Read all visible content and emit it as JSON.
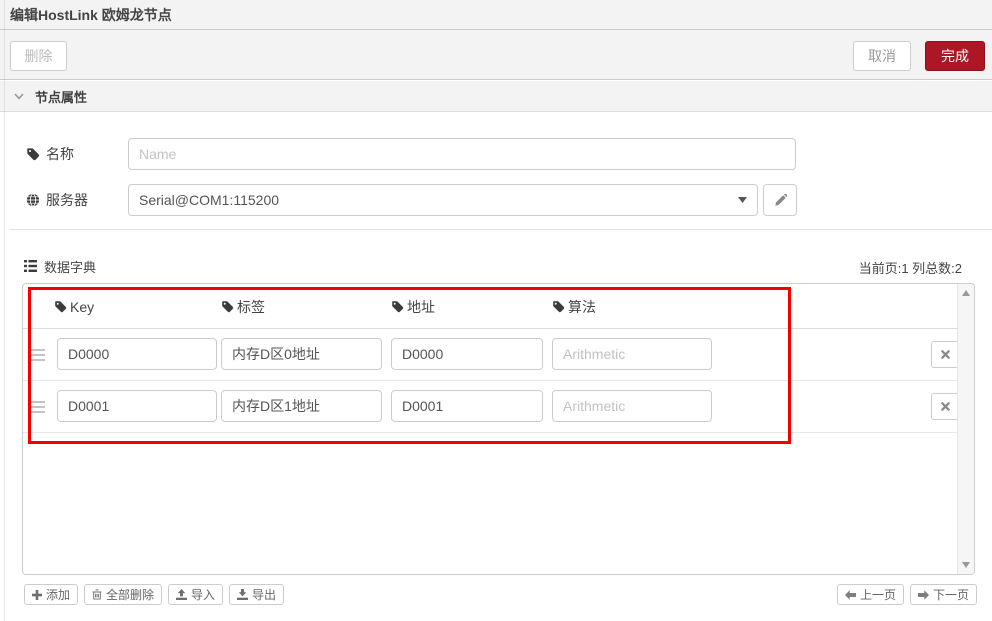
{
  "window": {
    "title": "编辑HostLink 欧姆龙节点"
  },
  "toolbar": {
    "delete": "删除",
    "cancel": "取消",
    "done": "完成"
  },
  "section": {
    "title": "节点属性"
  },
  "form": {
    "name_label": "名称",
    "name_placeholder": "Name",
    "server_label": "服务器",
    "server_value": "Serial@COM1:115200"
  },
  "dictionary": {
    "title": "数据字典",
    "page_info": "当前页:1  列总数:2",
    "columns": {
      "key": "Key",
      "label": "标签",
      "address": "地址",
      "algorithm": "算法"
    },
    "rows": [
      {
        "key": "D0000",
        "label": "内存D区0地址",
        "address": "D0000",
        "algorithm": "",
        "algorithm_placeholder": "Arithmetic"
      },
      {
        "key": "D0001",
        "label": "内存D区1地址",
        "address": "D0001",
        "algorithm": "",
        "algorithm_placeholder": "Arithmetic"
      }
    ],
    "actions": {
      "add": "添加",
      "delete_all": "全部删除",
      "import": "导入",
      "export": "导出"
    },
    "pagination": {
      "prev": "上一页",
      "next": "下一页"
    }
  },
  "colors": {
    "accent_red": "#ad1625",
    "annotation_red": "#f40000",
    "header_bg": "#f3f3f3"
  }
}
